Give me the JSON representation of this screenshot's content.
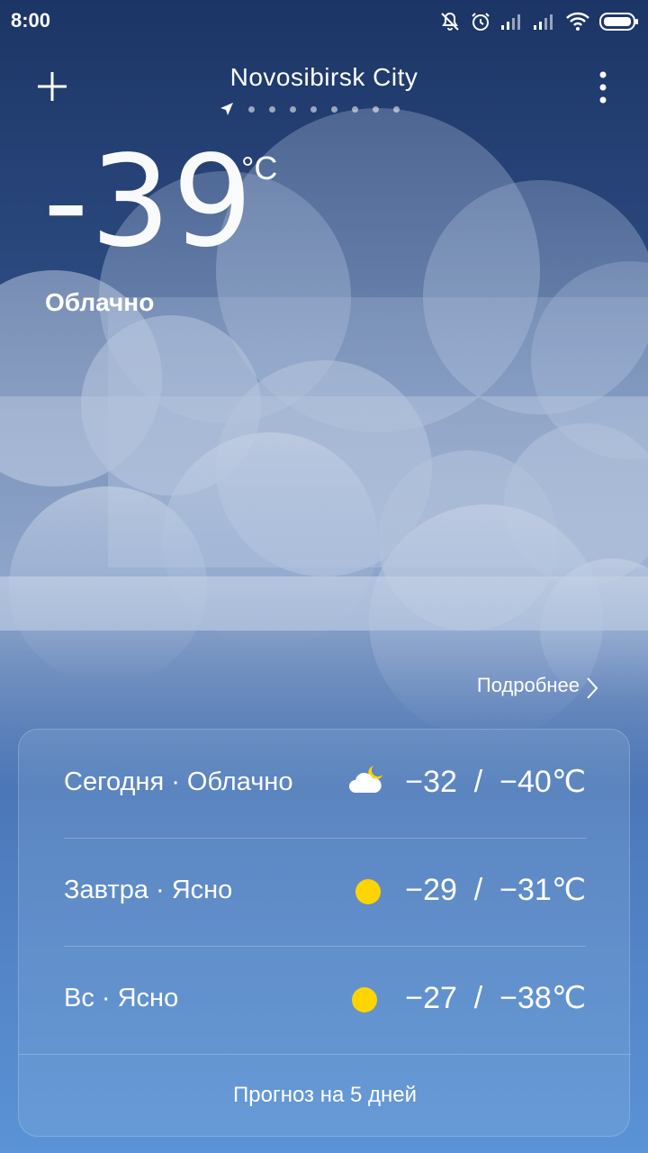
{
  "status_bar": {
    "time": "8:00",
    "icons": [
      "notifications-off-icon",
      "alarm-icon",
      "signal-icon",
      "signal-icon",
      "wifi-icon",
      "battery-icon"
    ]
  },
  "header": {
    "city": "Novosibirsk City",
    "add_icon": "plus-icon",
    "menu_icon": "more-vertical-icon",
    "location_icon": "location-arrow-icon",
    "page_count": 9,
    "active_page": 0
  },
  "current": {
    "temperature": "-39",
    "unit": "°C",
    "condition": "Облачно"
  },
  "more_link": {
    "label": "Подробнее"
  },
  "forecast": {
    "rows": [
      {
        "label": "Сегодня · Облачно",
        "icon": "cloud-moon-icon",
        "temps": "−32  /  −40℃"
      },
      {
        "label": "Завтра · Ясно",
        "icon": "sun-icon",
        "temps": "−29  /  −31℃"
      },
      {
        "label": "Вс · Ясно",
        "icon": "sun-icon",
        "temps": "−27  /  −38℃"
      }
    ],
    "five_day_label": "Прогноз на 5 дней"
  },
  "colors": {
    "background_top": "#1c3566",
    "background_bottom": "#5a93d6",
    "sun": "#ffd400",
    "text": "#ffffff"
  }
}
